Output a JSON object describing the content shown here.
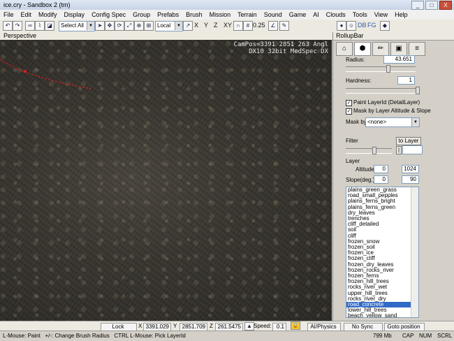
{
  "window": {
    "title": "ice.cry - Sandbox 2 (tm)",
    "min": "_",
    "max": "□",
    "close": "X"
  },
  "menu": [
    "File",
    "Edit",
    "Modify",
    "Display",
    "Config Spec",
    "Group",
    "Prefabs",
    "Brush",
    "Mission",
    "Terrain",
    "Sound",
    "Game",
    "AI",
    "Clouds",
    "Tools",
    "View",
    "Help"
  ],
  "toolbar": {
    "select_mode": "Select All",
    "coord_system": "Local",
    "axes": [
      "X",
      "Y",
      "Z",
      "XY"
    ],
    "snap_value": "0.25",
    "right_labels": [
      "DB",
      "FG"
    ]
  },
  "viewport": {
    "label": "Perspective",
    "campos_line1": "CamPos=3391 2851 263 Angl",
    "campos_line2": "DX10 32bit MedSpec DX"
  },
  "rollup": {
    "title": "RollupBar",
    "radius_label": "Radius:",
    "radius_value": "43.651",
    "hardness_label": "Hardness:",
    "hardness_value": "1",
    "paint_layer_label": "Paint LayerId (DetailLayer)",
    "mask_altitude_label": "Mask by Layer Altitude & Slope",
    "mask_by_label": "Mask by",
    "mask_by_value": "<none>",
    "filter_label": "Filter",
    "to_layer_button": "to Layer",
    "layer_label": "Layer",
    "altitude_label": "Altitude",
    "altitude_min": "0",
    "altitude_max": "1024",
    "slope_label": "Slope(deg.)",
    "slope_min": "0",
    "slope_max": "90",
    "layers": [
      "plains_green_grass",
      "road_small_pepples",
      "plains_ferns_bright",
      "plains_ferns_green",
      "dry_leaves",
      "trenches",
      "cliff_detailed",
      "soil",
      "cliff",
      "frozen_snow",
      "frozen_soil",
      "frozen_ice",
      "frozen_cliff",
      "frozen_dry_leaves",
      "frozen_rocks_river",
      "frozen_ferns",
      "frozen_hill_trees",
      "rocks_river_wet",
      "upper_hill_trees",
      "rocks_river_dry",
      "road_concrete",
      "lower_hill_trees",
      "beach_yellow_sand"
    ],
    "selected_layer": "road_concrete"
  },
  "status": {
    "lock_selection": "Lock Selection",
    "x": "3391.029",
    "y": "2851.709",
    "z": "261.5475",
    "speed_label": "Speed:",
    "speed_value": "0.1",
    "ai_physics": "AI/Physics",
    "no_sync": "No Sync Player",
    "goto": "Goto position"
  },
  "bottom": {
    "hint": "L-Mouse: Paint   +/-: Change Brush Radius   CTRL L-Mouse: Pick LayerId",
    "memory": "799 Mb",
    "caps": "CAP",
    "num": "NUM",
    "scrl": "SCRL"
  }
}
